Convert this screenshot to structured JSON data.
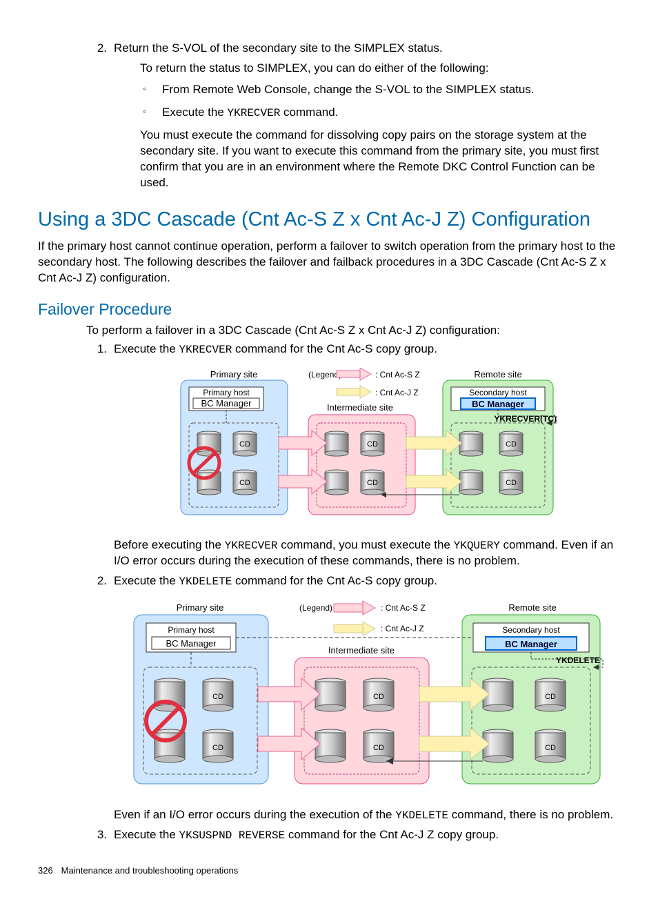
{
  "step2": {
    "num": "2.",
    "lead": "Return the S-VOL of the secondary site to the SIMPLEX status.",
    "sub1": "To return the status to SIMPLEX, you can do either of the following:",
    "bullet1": "From Remote Web Console, change the S-VOL to the SIMPLEX status.",
    "bullet2a": "Execute the ",
    "bullet2cmd": "YKRECVER",
    "bullet2b": " command.",
    "sub2": "You must execute the command for dissolving copy pairs on the storage system at the secondary site. If you want to execute this command from the primary site, you must first confirm that you are in an environment where the Remote DKC Control Function can be used."
  },
  "h1": "Using a 3DC Cascade (Cnt Ac-S Z x Cnt Ac-J Z) Configuration",
  "intro": "If the primary host cannot continue operation, perform a failover to switch operation from the primary host to the secondary host. The following describes the failover and failback procedures in a 3DC Cascade (Cnt Ac-S Z x Cnt Ac-J Z) configuration.",
  "h2": "Failover Procedure",
  "procIntro": "To perform a failover in a 3DC Cascade (Cnt Ac-S Z x Cnt Ac-J Z) configuration:",
  "stepA": {
    "num": "1.",
    "a": "Execute the ",
    "cmd": "YKRECVER",
    "b": " command for the Cnt Ac-S copy group."
  },
  "afterA": {
    "a": "Before executing the ",
    "cmd1": "YKRECVER",
    "b": " command, you must execute the ",
    "cmd2": "YKQUERY",
    "c": " command. Even if an I/O error occurs during the execution of these commands, there is no problem."
  },
  "stepB": {
    "num": "2.",
    "a": "Execute the ",
    "cmd": "YKDELETE",
    "b": " command for the Cnt Ac-S copy group."
  },
  "afterB": {
    "a": "Even if an I/O error occurs during the execution of the ",
    "cmd": "YKDELETE",
    "b": " command, there is no problem."
  },
  "stepC": {
    "num": "3.",
    "a": "Execute the ",
    "cmd": "YKSUSPND REVERSE",
    "b": " command for the Cnt Ac-J Z copy group."
  },
  "diag": {
    "primarySite": "Primary site",
    "primaryHost": "Primary host",
    "bcManager": "BC Manager",
    "legend": "(Legend)",
    "cntAcS": ": Cnt Ac-S Z",
    "cntAcJ": ": Cnt Ac-J Z",
    "intermediate": "Intermediate site",
    "remoteSite": "Remote site",
    "secondaryHost": "Secondary host",
    "cd": "CD",
    "cmd1": "YKRECVER(TC)",
    "cmd2": "YKDELETE"
  },
  "footer": {
    "page": "326",
    "title": "Maintenance and troubleshooting operations"
  }
}
